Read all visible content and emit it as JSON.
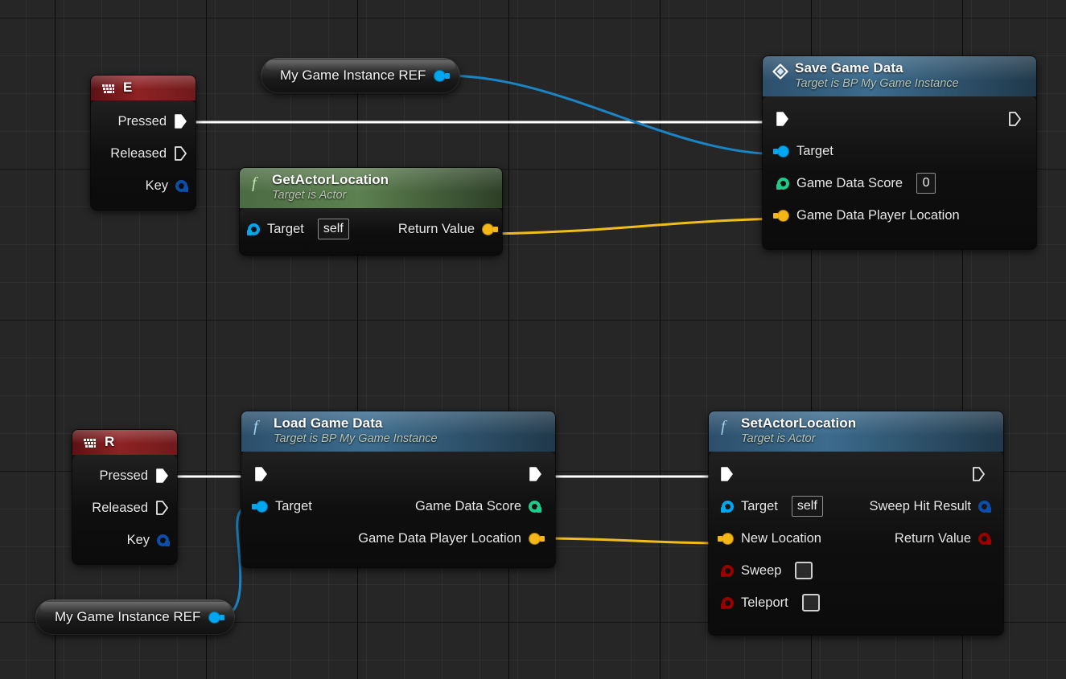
{
  "app": {
    "name": "Unreal Engine Blueprint Event Graph",
    "canvas_background": "#262626",
    "grid_minor": "#2f2f2f",
    "grid_major": "#0a0a0a"
  },
  "colors": {
    "exec_wire": "#ffffff",
    "object_pin": "#00a6f0",
    "object_wire": "#1b84c4",
    "vector_pin": "#f5b715",
    "vector_wire": "#f0bd1d",
    "float_pin": "#1ecb8a",
    "struct_pin": "#0d4fa8",
    "bool_pin": "#9a0000",
    "event_title": "#8e2224",
    "function_title": "#3c6c8e",
    "pure_function_title": "#5d8150"
  },
  "nodes": {
    "event_e": {
      "title": "E",
      "icon": "keyboard-event-icon",
      "pins": [
        {
          "label": "Pressed",
          "kind": "exec",
          "filled": true
        },
        {
          "label": "Released",
          "kind": "exec",
          "filled": false
        },
        {
          "label": "Key",
          "kind": "data",
          "type": "struct",
          "color": "#0d4fa8"
        }
      ]
    },
    "event_r": {
      "title": "R",
      "icon": "keyboard-event-icon",
      "pins": [
        {
          "label": "Pressed",
          "kind": "exec",
          "filled": true
        },
        {
          "label": "Released",
          "kind": "exec",
          "filled": false
        },
        {
          "label": "Key",
          "kind": "data",
          "type": "struct",
          "color": "#0d4fa8"
        }
      ]
    },
    "var_ref_top": {
      "label": "My Game Instance REF",
      "pin_color": "#00a6f0"
    },
    "var_ref_bottom": {
      "label": "My Game Instance REF",
      "pin_color": "#00a6f0"
    },
    "get_actor_location": {
      "title": "GetActorLocation",
      "subtitle": "Target is Actor",
      "icon": "function-f-icon",
      "inputs": [
        {
          "label": "Target",
          "type": "object",
          "color": "#00a6f0",
          "value": "self"
        }
      ],
      "outputs": [
        {
          "label": "Return Value",
          "type": "vector",
          "color": "#f5b715"
        }
      ]
    },
    "save_game_data": {
      "title": "Save Game Data",
      "subtitle": "Target is BP My Game Instance",
      "icon": "event-diamond-icon",
      "inputs": [
        {
          "label": "",
          "kind": "exec",
          "filled": true
        },
        {
          "label": "Target",
          "type": "object",
          "color": "#00a6f0"
        },
        {
          "label": "Game Data Score",
          "type": "float",
          "color": "#1ecb8a",
          "value": "0"
        },
        {
          "label": "Game Data Player Location",
          "type": "vector",
          "color": "#f5b715"
        }
      ],
      "outputs": [
        {
          "label": "",
          "kind": "exec",
          "filled": false
        }
      ]
    },
    "load_game_data": {
      "title": "Load Game Data",
      "subtitle": "Target is BP My Game Instance",
      "icon": "function-f-icon",
      "inputs": [
        {
          "label": "",
          "kind": "exec",
          "filled": true
        },
        {
          "label": "Target",
          "type": "object",
          "color": "#00a6f0"
        }
      ],
      "outputs": [
        {
          "label": "",
          "kind": "exec",
          "filled": true
        },
        {
          "label": "Game Data Score",
          "type": "float",
          "color": "#1ecb8a"
        },
        {
          "label": "Game Data Player Location",
          "type": "vector",
          "color": "#f5b715"
        }
      ]
    },
    "set_actor_location": {
      "title": "SetActorLocation",
      "subtitle": "Target is Actor",
      "icon": "function-f-icon",
      "inputs": [
        {
          "label": "",
          "kind": "exec",
          "filled": true
        },
        {
          "label": "Target",
          "type": "object",
          "color": "#00a6f0",
          "value": "self"
        },
        {
          "label": "New Location",
          "type": "vector",
          "color": "#f5b715"
        },
        {
          "label": "Sweep",
          "type": "bool",
          "color": "#9a0000",
          "checked": false
        },
        {
          "label": "Teleport",
          "type": "bool",
          "color": "#9a0000",
          "checked": false
        }
      ],
      "outputs": [
        {
          "label": "",
          "kind": "exec",
          "filled": false
        },
        {
          "label": "Sweep Hit Result",
          "type": "struct",
          "color": "#0d4fa8"
        },
        {
          "label": "Return Value",
          "type": "bool",
          "color": "#9a0000"
        }
      ]
    }
  }
}
